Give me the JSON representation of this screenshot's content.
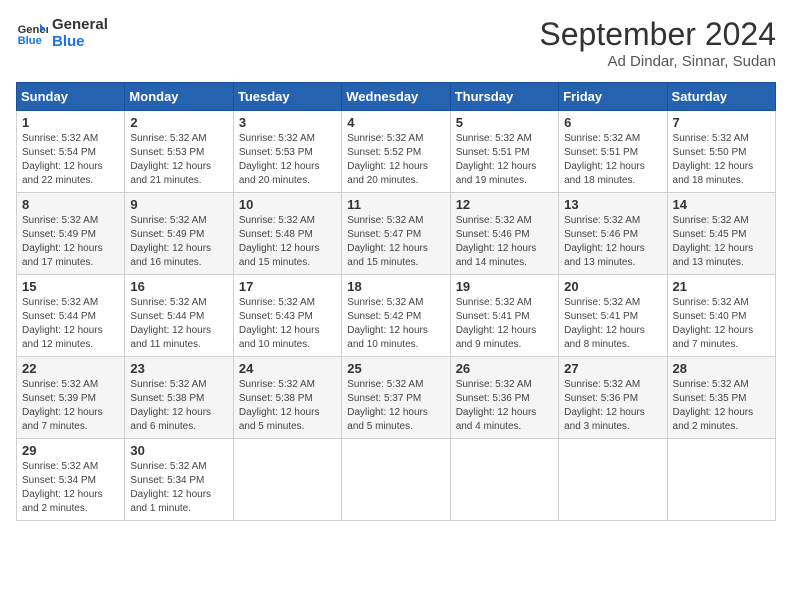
{
  "header": {
    "logo_line1": "General",
    "logo_line2": "Blue",
    "month": "September 2024",
    "location": "Ad Dindar, Sinnar, Sudan"
  },
  "weekdays": [
    "Sunday",
    "Monday",
    "Tuesday",
    "Wednesday",
    "Thursday",
    "Friday",
    "Saturday"
  ],
  "weeks": [
    [
      {
        "day": "1",
        "lines": [
          "Sunrise: 5:32 AM",
          "Sunset: 5:54 PM",
          "Daylight: 12 hours",
          "and 22 minutes."
        ]
      },
      {
        "day": "2",
        "lines": [
          "Sunrise: 5:32 AM",
          "Sunset: 5:53 PM",
          "Daylight: 12 hours",
          "and 21 minutes."
        ]
      },
      {
        "day": "3",
        "lines": [
          "Sunrise: 5:32 AM",
          "Sunset: 5:53 PM",
          "Daylight: 12 hours",
          "and 20 minutes."
        ]
      },
      {
        "day": "4",
        "lines": [
          "Sunrise: 5:32 AM",
          "Sunset: 5:52 PM",
          "Daylight: 12 hours",
          "and 20 minutes."
        ]
      },
      {
        "day": "5",
        "lines": [
          "Sunrise: 5:32 AM",
          "Sunset: 5:51 PM",
          "Daylight: 12 hours",
          "and 19 minutes."
        ]
      },
      {
        "day": "6",
        "lines": [
          "Sunrise: 5:32 AM",
          "Sunset: 5:51 PM",
          "Daylight: 12 hours",
          "and 18 minutes."
        ]
      },
      {
        "day": "7",
        "lines": [
          "Sunrise: 5:32 AM",
          "Sunset: 5:50 PM",
          "Daylight: 12 hours",
          "and 18 minutes."
        ]
      }
    ],
    [
      {
        "day": "8",
        "lines": [
          "Sunrise: 5:32 AM",
          "Sunset: 5:49 PM",
          "Daylight: 12 hours",
          "and 17 minutes."
        ]
      },
      {
        "day": "9",
        "lines": [
          "Sunrise: 5:32 AM",
          "Sunset: 5:49 PM",
          "Daylight: 12 hours",
          "and 16 minutes."
        ]
      },
      {
        "day": "10",
        "lines": [
          "Sunrise: 5:32 AM",
          "Sunset: 5:48 PM",
          "Daylight: 12 hours",
          "and 15 minutes."
        ]
      },
      {
        "day": "11",
        "lines": [
          "Sunrise: 5:32 AM",
          "Sunset: 5:47 PM",
          "Daylight: 12 hours",
          "and 15 minutes."
        ]
      },
      {
        "day": "12",
        "lines": [
          "Sunrise: 5:32 AM",
          "Sunset: 5:46 PM",
          "Daylight: 12 hours",
          "and 14 minutes."
        ]
      },
      {
        "day": "13",
        "lines": [
          "Sunrise: 5:32 AM",
          "Sunset: 5:46 PM",
          "Daylight: 12 hours",
          "and 13 minutes."
        ]
      },
      {
        "day": "14",
        "lines": [
          "Sunrise: 5:32 AM",
          "Sunset: 5:45 PM",
          "Daylight: 12 hours",
          "and 13 minutes."
        ]
      }
    ],
    [
      {
        "day": "15",
        "lines": [
          "Sunrise: 5:32 AM",
          "Sunset: 5:44 PM",
          "Daylight: 12 hours",
          "and 12 minutes."
        ]
      },
      {
        "day": "16",
        "lines": [
          "Sunrise: 5:32 AM",
          "Sunset: 5:44 PM",
          "Daylight: 12 hours",
          "and 11 minutes."
        ]
      },
      {
        "day": "17",
        "lines": [
          "Sunrise: 5:32 AM",
          "Sunset: 5:43 PM",
          "Daylight: 12 hours",
          "and 10 minutes."
        ]
      },
      {
        "day": "18",
        "lines": [
          "Sunrise: 5:32 AM",
          "Sunset: 5:42 PM",
          "Daylight: 12 hours",
          "and 10 minutes."
        ]
      },
      {
        "day": "19",
        "lines": [
          "Sunrise: 5:32 AM",
          "Sunset: 5:41 PM",
          "Daylight: 12 hours",
          "and 9 minutes."
        ]
      },
      {
        "day": "20",
        "lines": [
          "Sunrise: 5:32 AM",
          "Sunset: 5:41 PM",
          "Daylight: 12 hours",
          "and 8 minutes."
        ]
      },
      {
        "day": "21",
        "lines": [
          "Sunrise: 5:32 AM",
          "Sunset: 5:40 PM",
          "Daylight: 12 hours",
          "and 7 minutes."
        ]
      }
    ],
    [
      {
        "day": "22",
        "lines": [
          "Sunrise: 5:32 AM",
          "Sunset: 5:39 PM",
          "Daylight: 12 hours",
          "and 7 minutes."
        ]
      },
      {
        "day": "23",
        "lines": [
          "Sunrise: 5:32 AM",
          "Sunset: 5:38 PM",
          "Daylight: 12 hours",
          "and 6 minutes."
        ]
      },
      {
        "day": "24",
        "lines": [
          "Sunrise: 5:32 AM",
          "Sunset: 5:38 PM",
          "Daylight: 12 hours",
          "and 5 minutes."
        ]
      },
      {
        "day": "25",
        "lines": [
          "Sunrise: 5:32 AM",
          "Sunset: 5:37 PM",
          "Daylight: 12 hours",
          "and 5 minutes."
        ]
      },
      {
        "day": "26",
        "lines": [
          "Sunrise: 5:32 AM",
          "Sunset: 5:36 PM",
          "Daylight: 12 hours",
          "and 4 minutes."
        ]
      },
      {
        "day": "27",
        "lines": [
          "Sunrise: 5:32 AM",
          "Sunset: 5:36 PM",
          "Daylight: 12 hours",
          "and 3 minutes."
        ]
      },
      {
        "day": "28",
        "lines": [
          "Sunrise: 5:32 AM",
          "Sunset: 5:35 PM",
          "Daylight: 12 hours",
          "and 2 minutes."
        ]
      }
    ],
    [
      {
        "day": "29",
        "lines": [
          "Sunrise: 5:32 AM",
          "Sunset: 5:34 PM",
          "Daylight: 12 hours",
          "and 2 minutes."
        ]
      },
      {
        "day": "30",
        "lines": [
          "Sunrise: 5:32 AM",
          "Sunset: 5:34 PM",
          "Daylight: 12 hours",
          "and 1 minute."
        ]
      },
      null,
      null,
      null,
      null,
      null
    ]
  ]
}
